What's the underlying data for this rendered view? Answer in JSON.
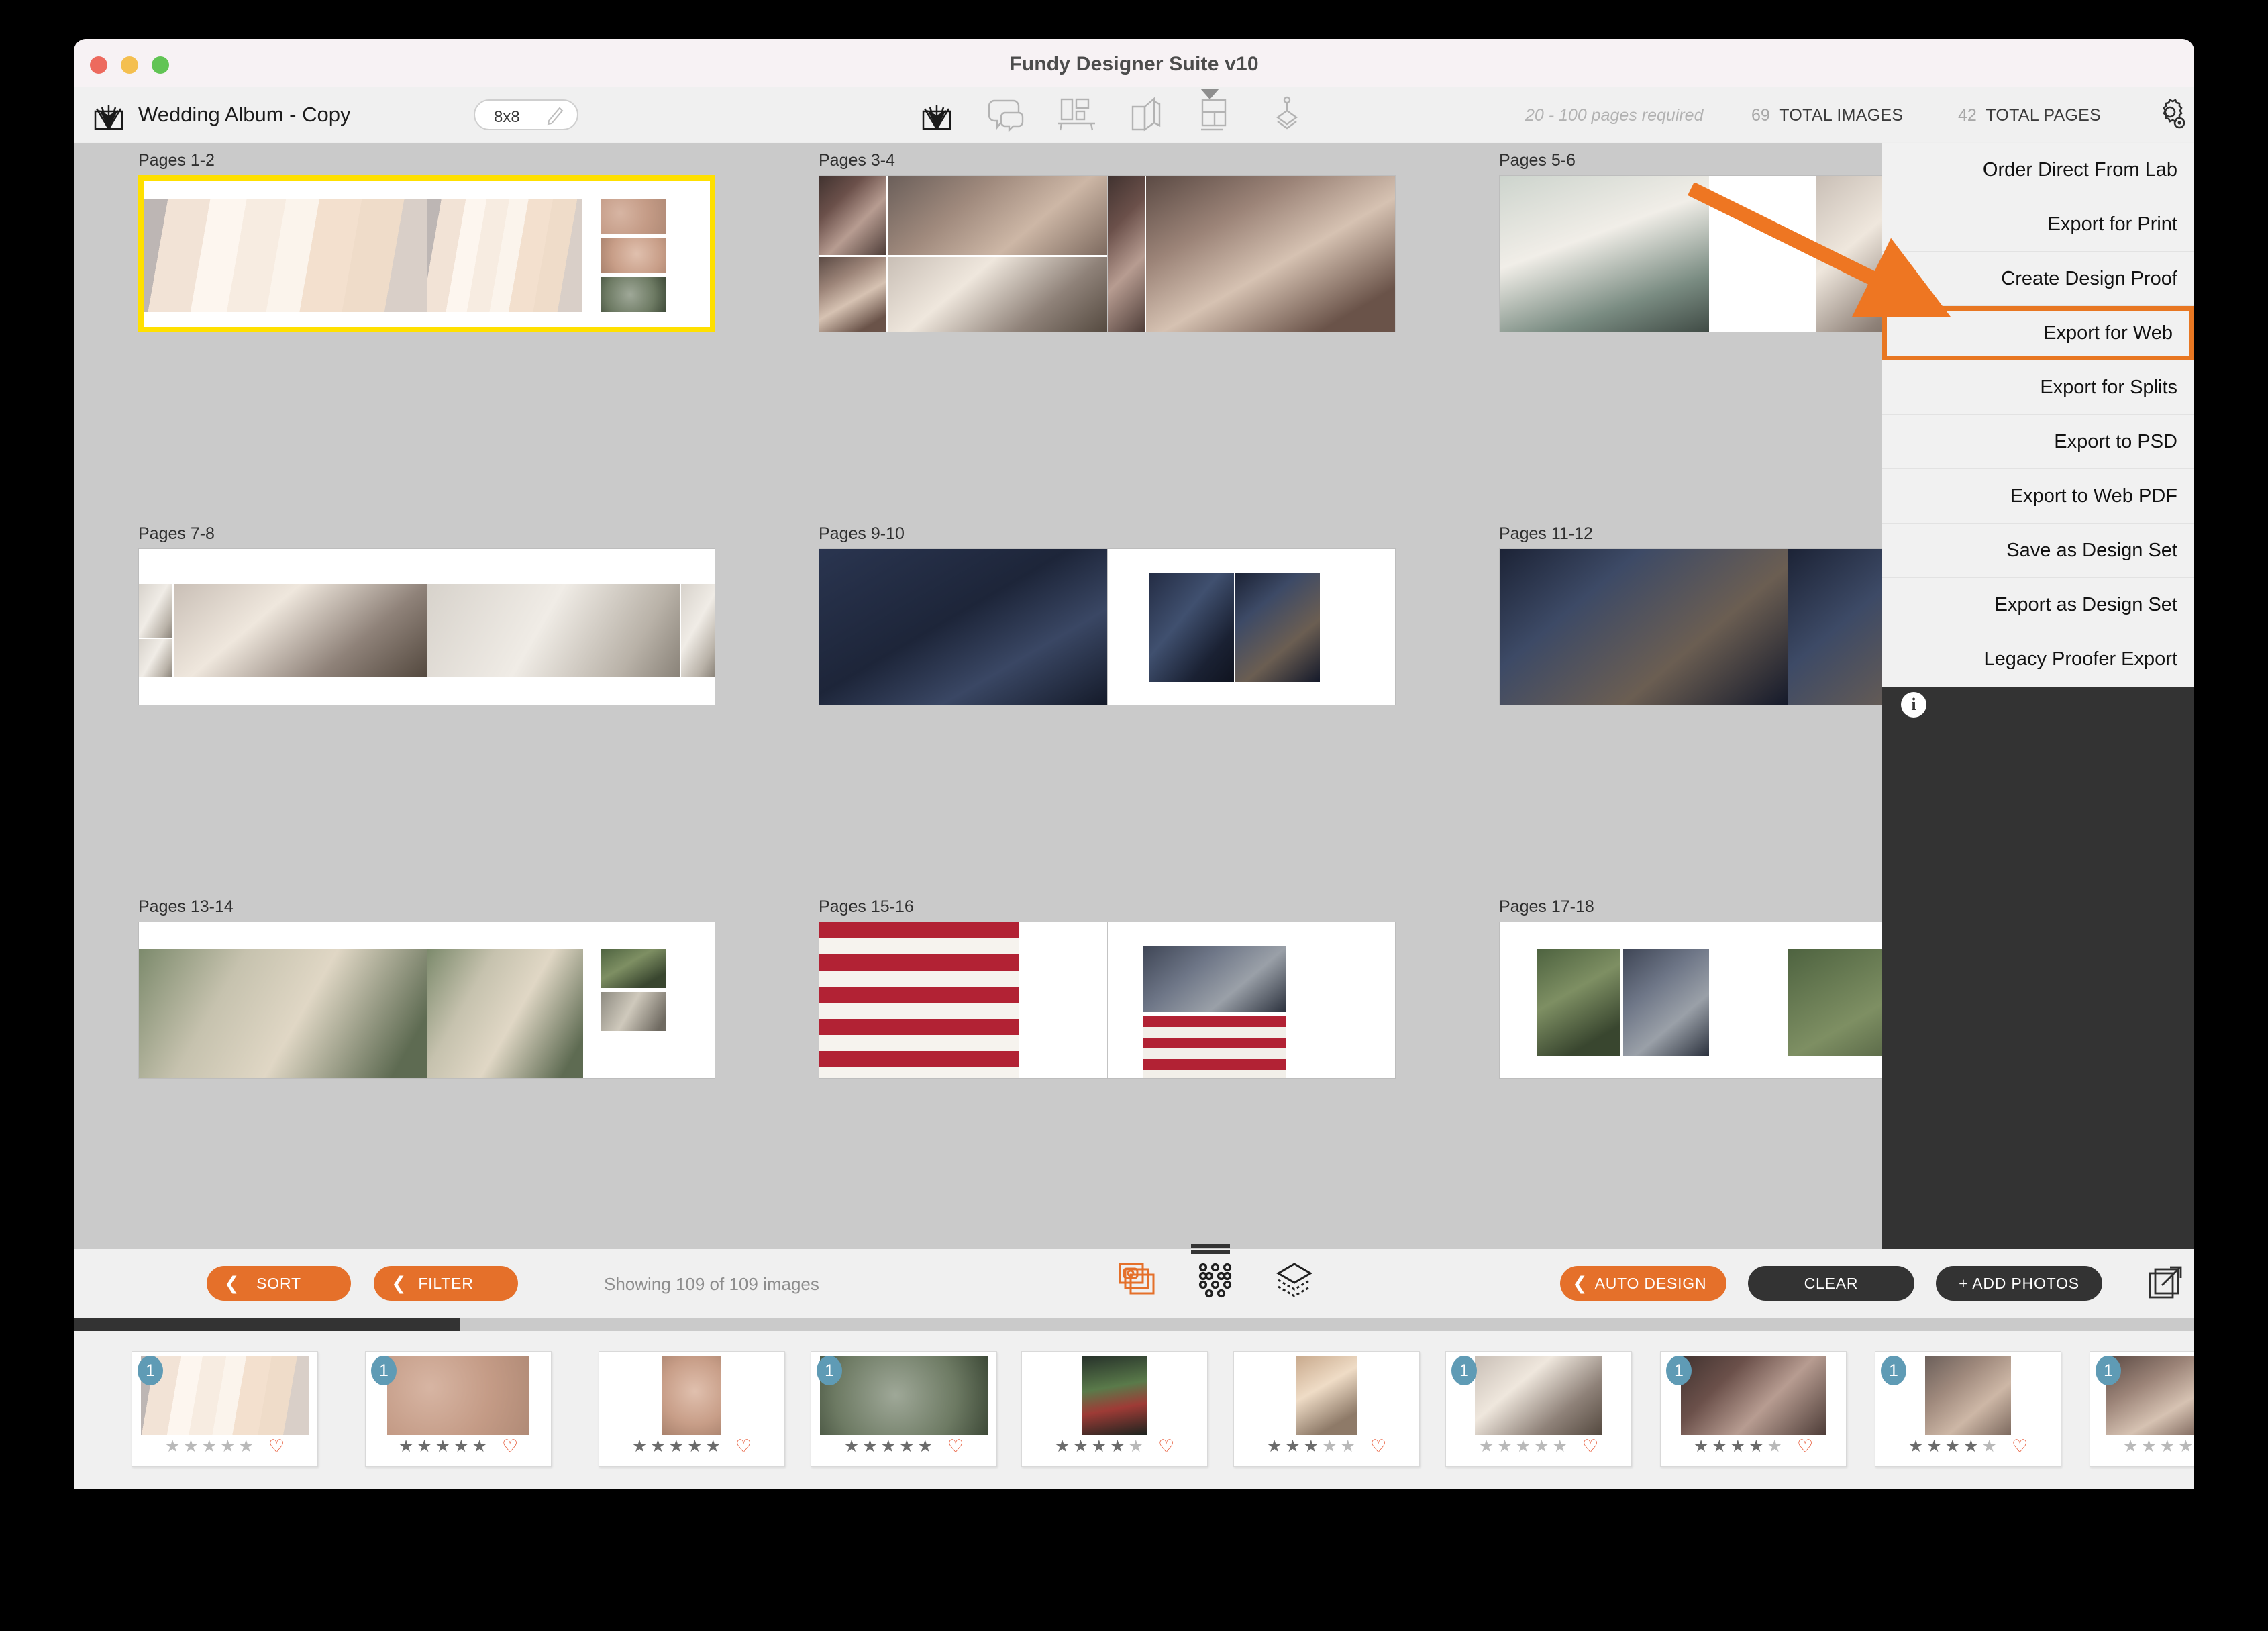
{
  "window": {
    "title": "Fundy Designer Suite v10",
    "traffic_lights": [
      "close",
      "minimize",
      "zoom"
    ]
  },
  "toolbar": {
    "album_title": "Wedding Album - Copy",
    "size_value": "8x8",
    "edit_icon": "pencil-icon",
    "tools": [
      {
        "name": "album-tool",
        "icon": "album-icon",
        "active": true
      },
      {
        "name": "design-tool",
        "icon": "speech-bubbles-icon",
        "active": false
      },
      {
        "name": "wall-art-tool",
        "icon": "wall-frames-icon",
        "active": false
      },
      {
        "name": "book-tool",
        "icon": "book-pages-icon",
        "active": false
      },
      {
        "name": "layout-tool",
        "icon": "grid-layout-icon",
        "active": false
      },
      {
        "name": "press-tool",
        "icon": "press-stack-icon",
        "active": false
      }
    ],
    "pages_required": "20 - 100 pages required",
    "total_images_count": "69",
    "total_images_label": "TOTAL IMAGES",
    "total_pages_count": "42",
    "total_pages_label": "TOTAL PAGES",
    "settings_icon": "gear-magnifier-icon",
    "share_icon": "export-arrow-icon"
  },
  "export_menu": {
    "items": [
      {
        "label": "Order Direct From Lab",
        "highlighted": false
      },
      {
        "label": "Export for Print",
        "highlighted": false
      },
      {
        "label": "Create Design Proof",
        "highlighted": false
      },
      {
        "label": "Export for Web",
        "highlighted": true
      },
      {
        "label": "Export for Splits",
        "highlighted": false
      },
      {
        "label": "Export to PSD",
        "highlighted": false
      },
      {
        "label": "Export to Web PDF",
        "highlighted": false
      },
      {
        "label": "Save as Design Set",
        "highlighted": false
      },
      {
        "label": "Export as Design Set",
        "highlighted": false
      },
      {
        "label": "Legacy Proofer Export",
        "highlighted": false
      }
    ],
    "info_icon": "info-icon",
    "highlight_color": "#e87722"
  },
  "annotation": {
    "arrow_color": "#ee7622",
    "points_to": "Export for Web"
  },
  "canvas": {
    "selection_color": "#ffe000",
    "spreads": [
      {
        "label": "Pages 1-2",
        "selected": true
      },
      {
        "label": "Pages 3-4",
        "selected": false
      },
      {
        "label": "Pages 5-6",
        "selected": false
      },
      {
        "label": "Pages 7-8",
        "selected": false
      },
      {
        "label": "Pages 9-10",
        "selected": false
      },
      {
        "label": "Pages 11-12",
        "selected": false
      },
      {
        "label": "Pages 13-14",
        "selected": false
      },
      {
        "label": "Pages 15-16",
        "selected": false
      },
      {
        "label": "Pages 17-18",
        "selected": false
      }
    ]
  },
  "bottom_bar": {
    "sort_label": "SORT",
    "filter_label": "FILTER",
    "showing_text": "Showing 109 of 109 images",
    "auto_design_label": "AUTO DESIGN",
    "clear_label": "CLEAR",
    "add_photos_label": "+ ADD PHOTOS",
    "center_icons": [
      {
        "name": "photo-stack-icon",
        "color": "#e5702a"
      },
      {
        "name": "dots-grid-icon",
        "color": "#333333"
      },
      {
        "name": "layers-icon",
        "color": "#333333"
      }
    ],
    "export_strip_icon": "export-frames-icon",
    "accent_color": "#e5702a",
    "dark_color": "#333333"
  },
  "filmstrip": {
    "thumbnails": [
      {
        "badge": "1",
        "rating": 0,
        "favorite": false,
        "photo": "dresses-on-rack"
      },
      {
        "badge": "1",
        "rating": 5,
        "favorite": false,
        "photo": "jewelry-flatlay"
      },
      {
        "badge": "",
        "rating": 5,
        "favorite": false,
        "photo": "ring-jewelry-closeup"
      },
      {
        "badge": "1",
        "rating": 5,
        "favorite": false,
        "photo": "ring-on-greenery"
      },
      {
        "badge": "",
        "rating": 4,
        "favorite": false,
        "photo": "bouquet-dark"
      },
      {
        "badge": "",
        "rating": 3,
        "favorite": false,
        "photo": "bride-hair-styling"
      },
      {
        "badge": "1",
        "rating": 0,
        "favorite": false,
        "photo": "bride-getting-ready"
      },
      {
        "badge": "1",
        "rating": 4,
        "favorite": false,
        "photo": "bride-with-mother"
      },
      {
        "badge": "1",
        "rating": 4,
        "favorite": false,
        "photo": "bride-reading-letter"
      },
      {
        "badge": "1",
        "rating": 0,
        "favorite": false,
        "photo": "bride-and-flower-girl"
      }
    ],
    "badge_color": "#5f9bb5",
    "heart_color": "#e5451f"
  }
}
